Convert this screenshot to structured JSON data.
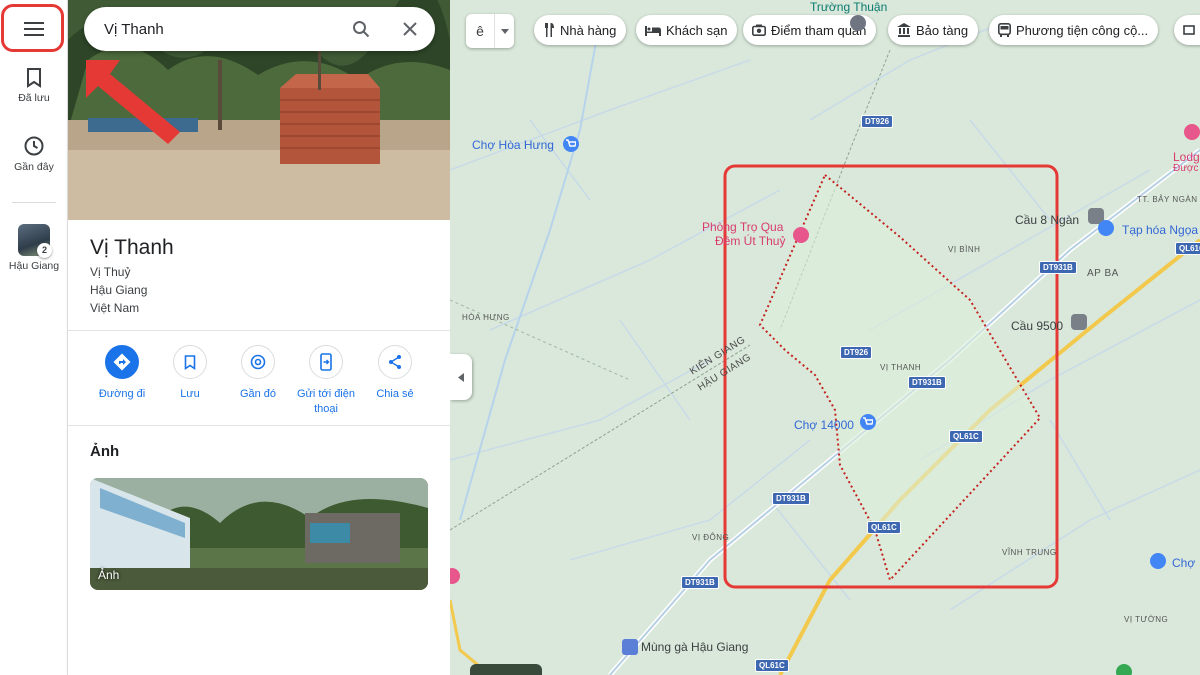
{
  "rail": {
    "saved_label": "Đã lưu",
    "recent_label": "Gần đây",
    "recent_place_label": "Hậu Giang",
    "recent_place_badge": "2"
  },
  "search": {
    "value": "Vị Thanh"
  },
  "place": {
    "title": "Vị Thanh",
    "address": [
      "Vị Thuỷ",
      "Hậu Giang",
      "Việt Nam"
    ]
  },
  "actions": [
    {
      "label": "Đường đi",
      "icon": "directions-icon"
    },
    {
      "label": "Lưu",
      "icon": "bookmark-icon"
    },
    {
      "label": "Gần đó",
      "icon": "nearby-icon"
    },
    {
      "label": "Gửi tới điện thoại",
      "icon": "send-to-phone-icon"
    },
    {
      "label": "Chia sẻ",
      "icon": "share-icon"
    }
  ],
  "photos": {
    "title": "Ảnh",
    "label": "Ảnh"
  },
  "map": {
    "layer_toggle": "ê",
    "chips": [
      "Nhà hàng",
      "Khách sạn",
      "Điểm tham quan",
      "Bảo tàng",
      "Phương tiện công cộ..."
    ],
    "places": {
      "truong_thuan": "Trường Thuận",
      "cho_hoa_hung": "Chợ Hòa Hưng",
      "phong_tro_1": "Phòng Trọ Qua",
      "phong_tro_2": "Đêm Út Thuỷ",
      "cau_8_ngan": "Cầu 8 Ngàn",
      "cau_9500": "Cầu 9500",
      "cho_14000": "Chợ 14000",
      "tap_hoa": "Tạp hóa Ngọa",
      "lodge_1": "Lodg",
      "lodge_2": "Được",
      "cho_right": "Chợ",
      "mung_ga": "Mùng gà Hậu Giang"
    },
    "areas": {
      "vi_binh": "VỊ BÌNH",
      "vi_thanh": "VỊ THANH",
      "hoa_hung": "HÒA HƯNG",
      "vi_dong": "VỊ ĐÔNG",
      "vinh_trung": "VĨNH TRUNG",
      "vi_tuong": "VỊ TƯỜNG",
      "ap_ba": "AP BA",
      "tt_bay_ngan": "TT. BẢY NGÀN",
      "kien_giang": "KIÊN GIANG",
      "hau_giang": "HẬU GIANG"
    },
    "roads": {
      "dt926_a": "DT926",
      "dt926_b": "DT926",
      "dt931b_a": "DT931B",
      "dt931b_b": "DT931B",
      "dt931b_c": "DT931B",
      "dt931b_d": "DT931B",
      "ql61c_a": "QL61C",
      "ql61c_b": "QL61C",
      "ql61c_c": "QL61C",
      "ql61c_d": "QL61C"
    },
    "colors": {
      "boundary": "#c5221f",
      "highlight": "#e53935",
      "road_shield": "#3d67b1",
      "highway": "#f2c94c"
    }
  }
}
